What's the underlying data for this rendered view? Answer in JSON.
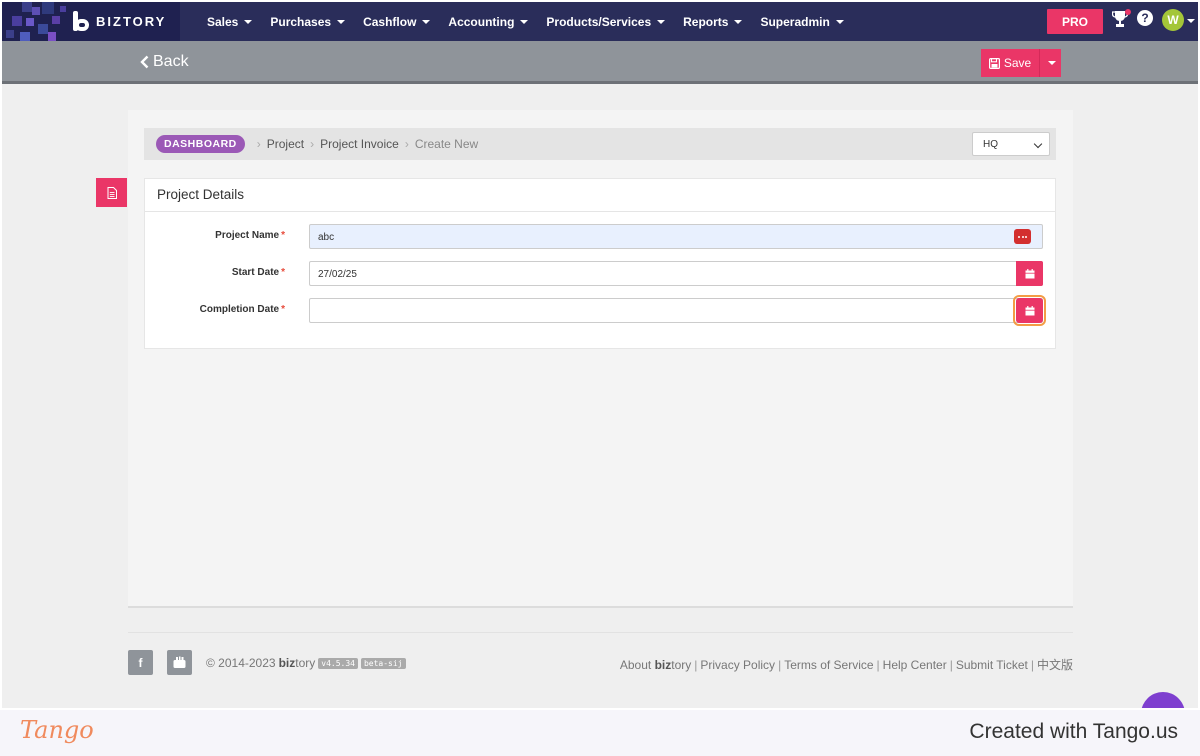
{
  "app": {
    "brand": "BIZTORY"
  },
  "nav": {
    "items": [
      {
        "label": "Sales"
      },
      {
        "label": "Purchases"
      },
      {
        "label": "Cashflow"
      },
      {
        "label": "Accounting"
      },
      {
        "label": "Products/Services"
      },
      {
        "label": "Reports"
      },
      {
        "label": "Superadmin"
      }
    ],
    "pro_label": "PRO",
    "help_label": "?",
    "avatar_initial": "W"
  },
  "subbar": {
    "back_label": "Back",
    "save_label": "Save"
  },
  "breadcrumb": {
    "dashboard": "DASHBOARD",
    "items": [
      "Project",
      "Project Invoice"
    ],
    "current": "Create New",
    "branch_select": "HQ"
  },
  "card": {
    "title": "Project Details",
    "fields": [
      {
        "label": "Project Name",
        "value": "abc",
        "placeholder": ""
      },
      {
        "label": "Start Date",
        "value": "27/02/25",
        "placeholder": ""
      },
      {
        "label": "Completion Date",
        "value": "",
        "placeholder": ""
      }
    ],
    "required_mark": "*"
  },
  "footer": {
    "copyright_prefix": "© 2014-2023",
    "brand_bold": "biz",
    "brand_rest": "tory",
    "version": "v4.5.34",
    "build": "beta-sij",
    "links": {
      "about_prefix": "About",
      "about_bold": "biz",
      "about_rest": "tory",
      "privacy": "Privacy Policy",
      "terms": "Terms of Service",
      "help": "Help Center",
      "ticket": "Submit Ticket",
      "lang": "中文版"
    },
    "separator": "|"
  },
  "tango": {
    "logo": "Tango",
    "credit": "Created with Tango.us"
  },
  "colors": {
    "accent": "#ea3667",
    "navbar": "#2a2d5a",
    "subbar": "#8f949a",
    "dashboard_pill": "#9b59b6"
  }
}
